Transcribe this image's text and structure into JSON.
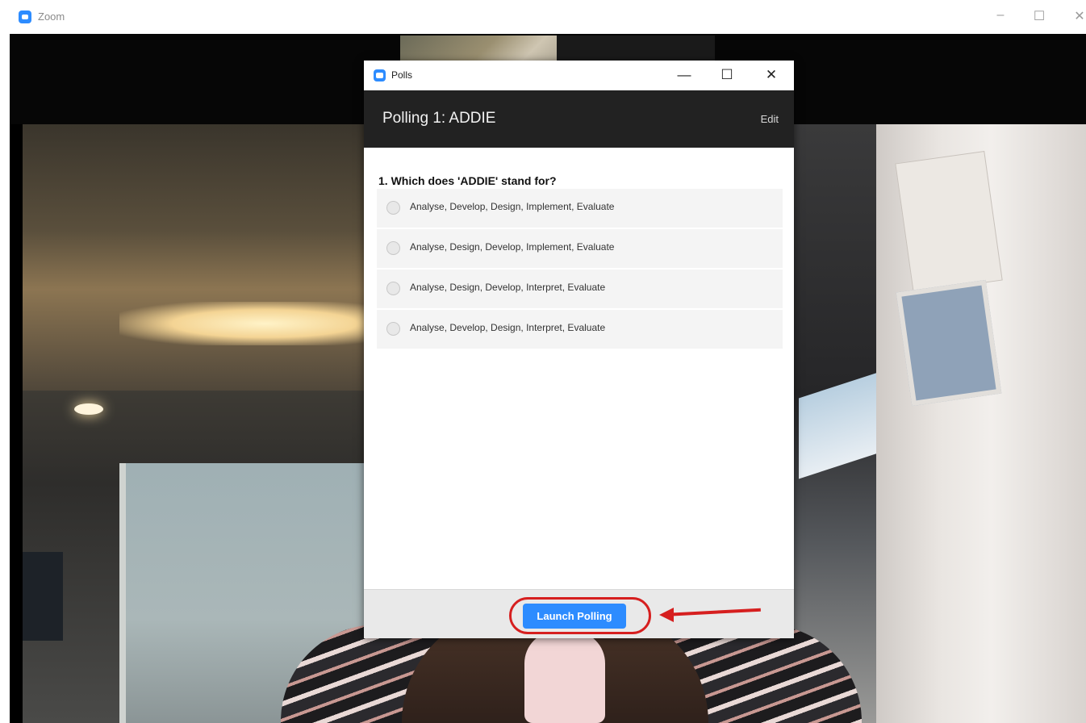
{
  "app": {
    "title": "Zoom",
    "window_controls": {
      "minimize": "–",
      "maximize": "☐",
      "close": "✕"
    }
  },
  "polls_window": {
    "title": "Polls",
    "controls": {
      "minimize": "—",
      "maximize": "☐",
      "close": "✕"
    },
    "poll_name": "Polling 1: ADDIE",
    "edit_label": "Edit",
    "question": "1. Which does 'ADDIE' stand for?",
    "options": [
      "Analyse, Develop, Design, Implement, Evaluate",
      "Analyse, Design, Develop, Implement, Evaluate",
      "Analyse, Design, Develop, Interpret, Evaluate",
      "Analyse, Develop, Design, Interpret, Evaluate"
    ],
    "launch_label": "Launch Polling"
  },
  "colors": {
    "accent": "#2d8cff",
    "header_bg": "#222222",
    "annotation": "#d61f1f"
  }
}
